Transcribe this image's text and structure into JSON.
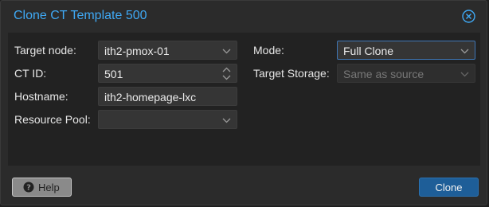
{
  "dialog": {
    "title": "Clone CT Template 500",
    "close_icon": "close-circle-icon"
  },
  "form": {
    "target_node": {
      "label": "Target node:",
      "value": "ith2-pmox-01"
    },
    "ct_id": {
      "label": "CT ID:",
      "value": "501"
    },
    "hostname": {
      "label": "Hostname:",
      "value": "ith2-homepage-lxc"
    },
    "resource_pool": {
      "label": "Resource Pool:",
      "value": ""
    },
    "mode": {
      "label": "Mode:",
      "value": "Full Clone"
    },
    "target_storage": {
      "label": "Target Storage:",
      "placeholder": "Same as source"
    }
  },
  "footer": {
    "help_label": "Help",
    "clone_label": "Clone"
  },
  "colors": {
    "title": "#3fa9f5",
    "primary_button": "#1e5e98",
    "focus_border": "#3f77b6"
  }
}
